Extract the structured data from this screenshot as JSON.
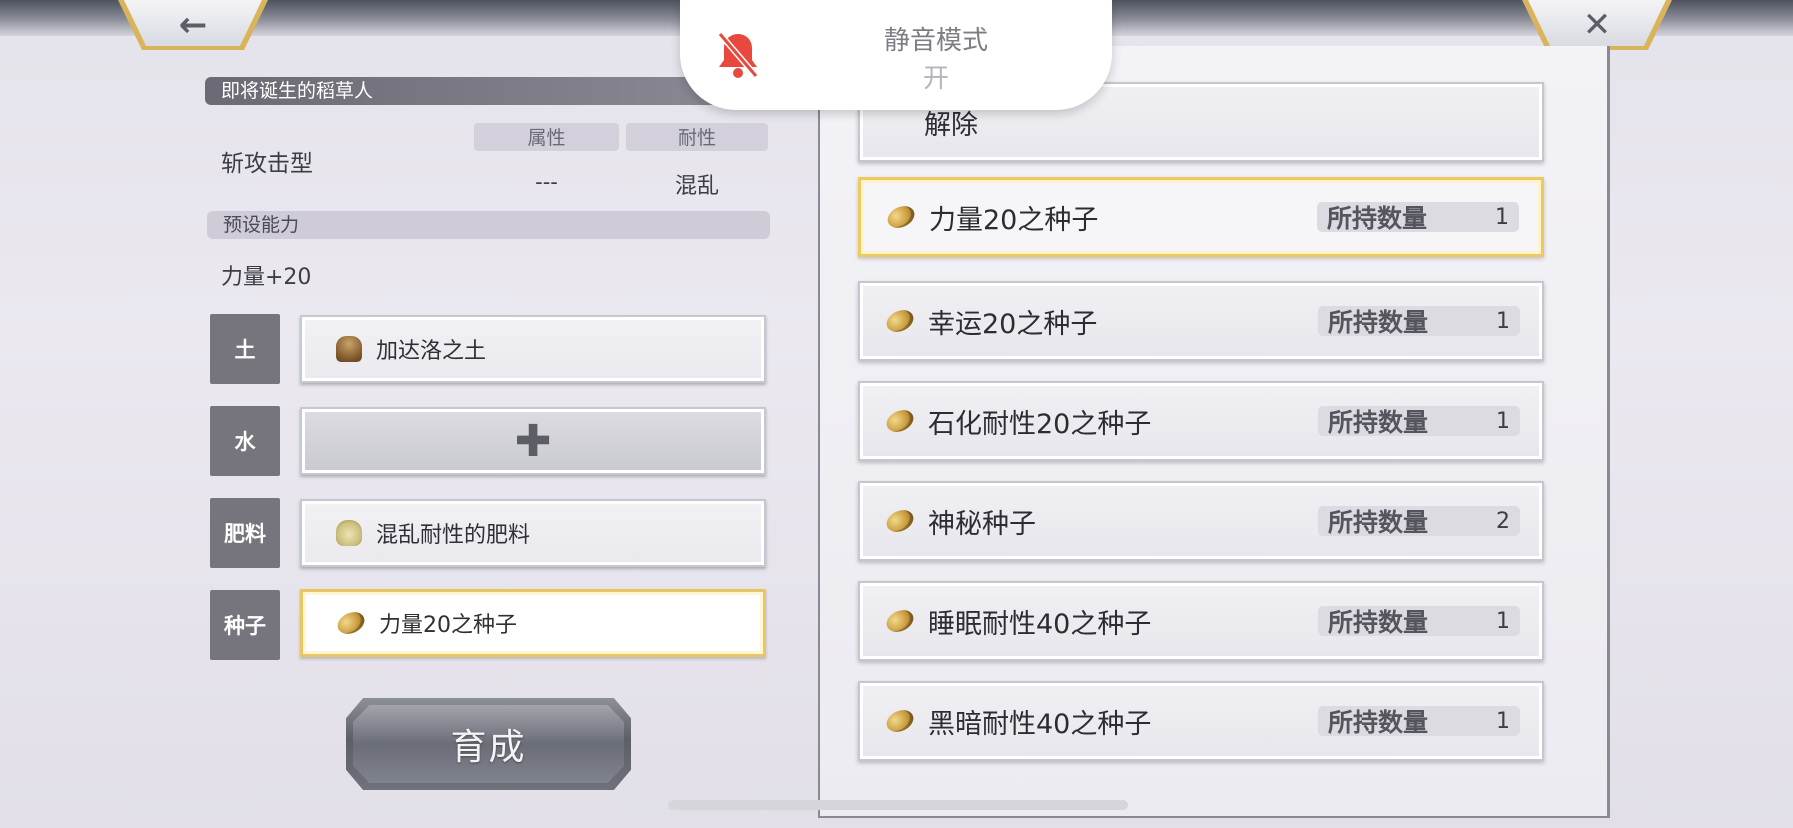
{
  "nav": {
    "back_glyph": "←",
    "close_glyph": "✕"
  },
  "toast": {
    "title": "静音模式",
    "state": "开",
    "icon": "bell-slash-icon",
    "icon_color": "#e9483e"
  },
  "left": {
    "header": "即将诞生的稻草人",
    "type_label": "斩攻击型",
    "attr_header": "属性",
    "resist_header": "耐性",
    "attr_value": "---",
    "resist_value": "混乱",
    "preset_header": "预设能力",
    "preset_value": "力量+20",
    "slots": [
      {
        "label": "土",
        "item": "加达洛之土",
        "icon": "soil-icon"
      },
      {
        "label": "水",
        "item": "",
        "icon": "plus-icon"
      },
      {
        "label": "肥料",
        "item": "混乱耐性的肥料",
        "icon": "fertilizer-bag-icon"
      },
      {
        "label": "种子",
        "item": "力量20之种子",
        "icon": "seed-icon"
      }
    ],
    "grow_button": "育成"
  },
  "right": {
    "remove_label": "解除",
    "qty_label": "所持数量",
    "items": [
      {
        "name": "力量20之种子",
        "qty": "1",
        "selected": true
      },
      {
        "name": "幸运20之种子",
        "qty": "1"
      },
      {
        "name": "石化耐性20之种子",
        "qty": "1"
      },
      {
        "name": "神秘种子",
        "qty": "2"
      },
      {
        "name": "睡眠耐性40之种子",
        "qty": "1"
      },
      {
        "name": "黑暗耐性40之种子",
        "qty": "1"
      }
    ]
  },
  "colors": {
    "accent_gold": "#e7c663",
    "slot_label_bg": "#76757d"
  }
}
